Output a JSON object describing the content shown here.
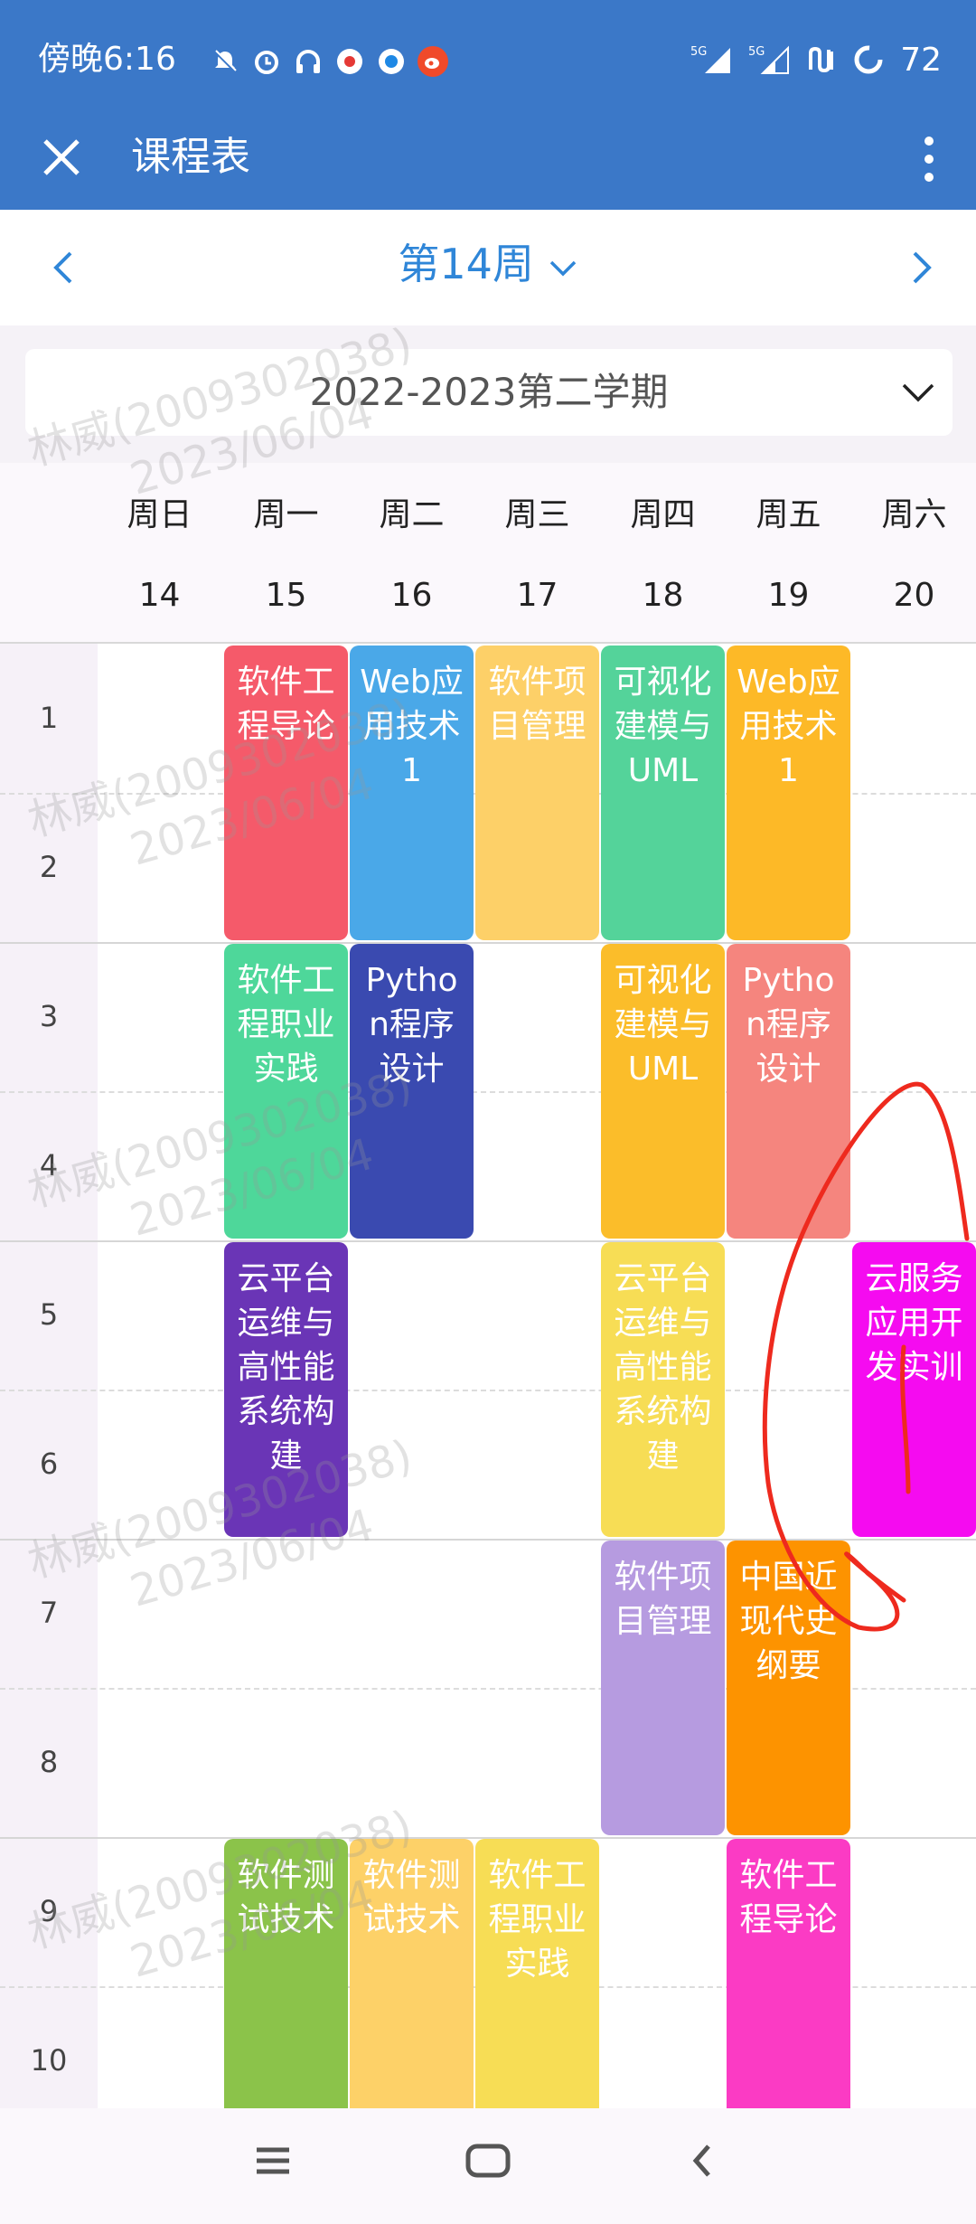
{
  "status_bar": {
    "time": "傍晚6:16",
    "network1": "5G",
    "network2": "5G",
    "battery": "72"
  },
  "app_bar": {
    "title": "课程表"
  },
  "week_nav": {
    "title": "第14周"
  },
  "semester": {
    "selected": "2022-2023第二学期"
  },
  "days": [
    {
      "name": "周日",
      "date": "14"
    },
    {
      "name": "周一",
      "date": "15"
    },
    {
      "name": "周二",
      "date": "16"
    },
    {
      "name": "周三",
      "date": "17"
    },
    {
      "name": "周四",
      "date": "18"
    },
    {
      "name": "周五",
      "date": "19"
    },
    {
      "name": "周六",
      "date": "20"
    }
  ],
  "periods": [
    "1",
    "2",
    "3",
    "4",
    "5",
    "6",
    "7",
    "8",
    "9",
    "10"
  ],
  "courses": [
    {
      "name": "软件工程导论",
      "day": 1,
      "start": 1,
      "span": 2,
      "color": "#f55a6a"
    },
    {
      "name": "Web应用技术1",
      "day": 2,
      "start": 1,
      "span": 2,
      "color": "#4aa8e8"
    },
    {
      "name": "软件项目管理",
      "day": 3,
      "start": 1,
      "span": 2,
      "color": "#fdd068"
    },
    {
      "name": "可视化建模与UML",
      "day": 4,
      "start": 1,
      "span": 2,
      "color": "#54d39a"
    },
    {
      "name": "Web应用技术1",
      "day": 5,
      "start": 1,
      "span": 2,
      "color": "#fdb927"
    },
    {
      "name": "软件工程职业实践",
      "day": 1,
      "start": 3,
      "span": 2,
      "color": "#4ed79a"
    },
    {
      "name": "Python程序设计",
      "day": 2,
      "start": 3,
      "span": 2,
      "color": "#3a4ab0"
    },
    {
      "name": "可视化建模与UML",
      "day": 4,
      "start": 3,
      "span": 2,
      "color": "#fbbd2a"
    },
    {
      "name": "Python程序设计",
      "day": 5,
      "start": 3,
      "span": 2,
      "color": "#f5857e"
    },
    {
      "name": "云平台运维与高性能系统构建",
      "day": 1,
      "start": 5,
      "span": 2,
      "color": "#6a35b6"
    },
    {
      "name": "云平台运维与高性能系统构建",
      "day": 4,
      "start": 5,
      "span": 2,
      "color": "#f7dd55"
    },
    {
      "name": "云服务应用开发实训",
      "day": 6,
      "start": 5,
      "span": 2,
      "color": "#f50bf0"
    },
    {
      "name": "软件项目管理",
      "day": 4,
      "start": 7,
      "span": 2,
      "color": "#b69be0"
    },
    {
      "name": "中国近现代史纲要",
      "day": 5,
      "start": 7,
      "span": 2,
      "color": "#fd9300"
    },
    {
      "name": "软件测试技术",
      "day": 1,
      "start": 9,
      "span": 2,
      "color": "#8bc34a"
    },
    {
      "name": "软件测试技术",
      "day": 2,
      "start": 9,
      "span": 2,
      "color": "#fdd168"
    },
    {
      "name": "软件工程职业实践",
      "day": 3,
      "start": 9,
      "span": 2,
      "color": "#f7dd55"
    },
    {
      "name": "软件工程导论",
      "day": 5,
      "start": 9,
      "span": 2,
      "color": "#fb3bc4"
    }
  ],
  "watermark": {
    "name": "林威(2009302038)",
    "date": "2023/06/04"
  },
  "colors": {
    "header": "#3b78c8",
    "accent": "#2f86d8"
  }
}
